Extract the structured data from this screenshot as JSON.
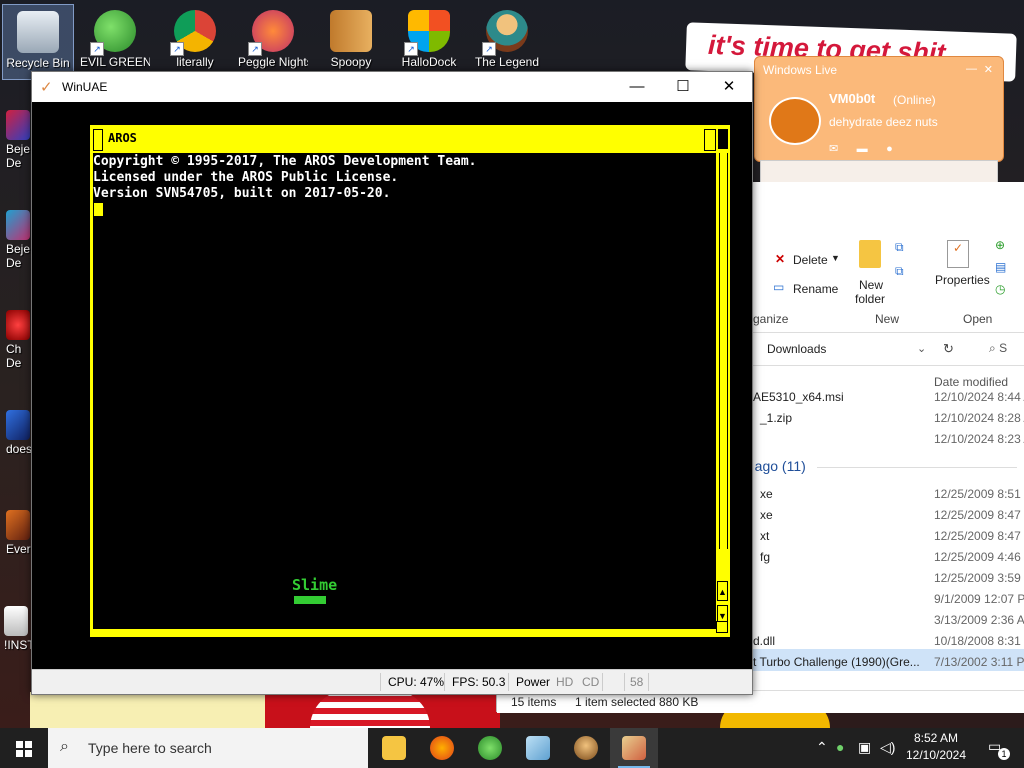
{
  "wallpaper": {
    "sign_text": "it's time to get shit"
  },
  "desktop_icons": [
    {
      "label": "Recycle Bin",
      "icon": "recycle-bin-icon",
      "selected": true
    },
    {
      "label": "EVIL GREEN",
      "icon": "messenger-buddies-icon"
    },
    {
      "label": "literally",
      "icon": "chrome-icon"
    },
    {
      "label": "Peggle Nights",
      "icon": "peggle-icon"
    },
    {
      "label": "Spoopy",
      "icon": "folder-door-icon"
    },
    {
      "label": "HalloDock",
      "icon": "windows-shield-icon"
    },
    {
      "label": "The Legend",
      "icon": "legend-character-icon"
    }
  ],
  "left_icons": [
    {
      "label": "Beje",
      "label2": "De",
      "icon": "bejeweled-icon"
    },
    {
      "label": "Beje",
      "label2": "De",
      "icon": "bejeweled-icon"
    },
    {
      "label": "Ch",
      "label2": "De",
      "icon": "chuzzle-icon"
    },
    {
      "label": "does",
      "label2": "",
      "icon": "app-icon"
    },
    {
      "label": "Ever",
      "label2": "",
      "icon": "app-icon"
    },
    {
      "label": "!INST",
      "label2": "",
      "icon": "installer-icon"
    }
  ],
  "messenger": {
    "title": "Windows Live",
    "name": "VM0b0t",
    "status": "(Online)",
    "personal_message": "dehydrate deez nuts"
  },
  "explorer": {
    "ribbon": {
      "delete": "Delete",
      "rename": "Rename",
      "organize": "ganize",
      "new_folder_1": "New",
      "new_folder_2": "folder",
      "new_group": "New",
      "properties": "Properties",
      "open_group": "Open"
    },
    "address": {
      "path": "Downloads",
      "search_hint": "S"
    },
    "column_date": "Date modified",
    "group_label": "e ago (11)",
    "files": [
      {
        "name": "AE5310_x64.msi",
        "date": "12/10/2024 8:44 A"
      },
      {
        "name": "_1.zip",
        "date": "12/10/2024 8:28 A"
      },
      {
        "name": "",
        "date": "12/10/2024 8:23 A"
      },
      {
        "name": "xe",
        "date": "12/25/2009 8:51 P"
      },
      {
        "name": "xe",
        "date": "12/25/2009 8:47 P"
      },
      {
        "name": "xt",
        "date": "12/25/2009 8:47 P"
      },
      {
        "name": "fg",
        "date": "12/25/2009 4:46 P"
      },
      {
        "name": "",
        "date": "12/25/2009 3:59 P"
      },
      {
        "name": "",
        "date": "9/1/2009 12:07 P"
      },
      {
        "name": "",
        "date": "3/13/2009 2:36 A"
      },
      {
        "name": "d.dll",
        "date": "10/18/2008 8:31 P"
      },
      {
        "name": "t Turbo Challenge (1990)(Gre...",
        "date": "7/13/2002 3:11 P",
        "selected": true
      }
    ],
    "status": {
      "count": "15 items",
      "selection": "1 item selected",
      "size": "880 KB"
    }
  },
  "winuae": {
    "title": "WinUAE",
    "controls": {
      "minimize": "—",
      "maximize": "☐",
      "close": "✕"
    },
    "aros": {
      "title": "AROS",
      "console_lines": [
        "Copyright © 1995-2017, The AROS Development Team.",
        "Licensed under the AROS Public License.",
        "Version SVN54705, built on 2017-05-20."
      ],
      "logo": "Slime"
    },
    "status": {
      "cpu": "CPU: 47%",
      "fps": "FPS: 50.3",
      "power": "Power",
      "hd": "HD",
      "cd": "CD",
      "drive": "58"
    }
  },
  "taskbar": {
    "search_placeholder": "Type here to search",
    "apps": [
      "file-explorer-icon",
      "firefox-icon",
      "messenger-buddies-icon",
      "notepad-icon",
      "character-app-icon",
      "winuae-icon"
    ],
    "clock_time": "8:52 AM",
    "clock_date": "12/10/2024",
    "notification_count": "1"
  }
}
